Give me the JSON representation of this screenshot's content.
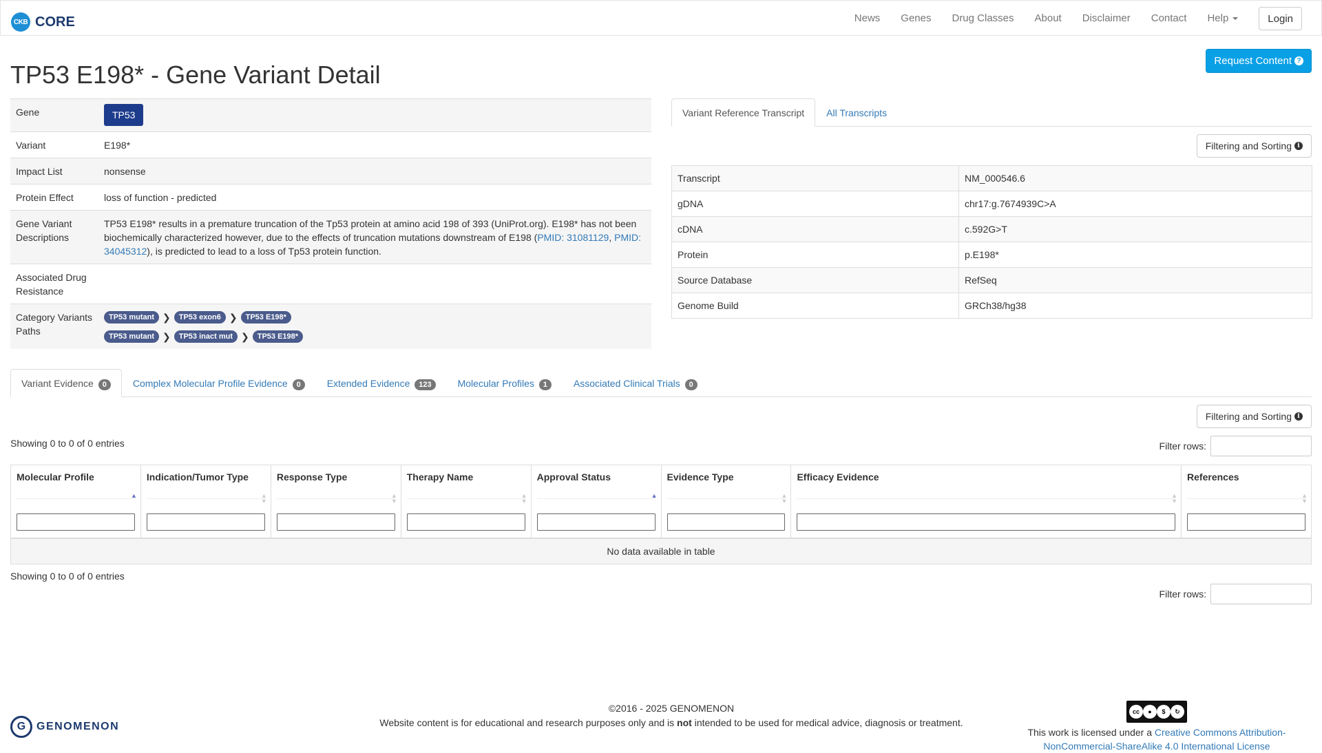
{
  "nav": {
    "brand_logo": "CKB",
    "brand_text": "CORE",
    "links": [
      "News",
      "Genes",
      "Drug Classes",
      "About",
      "Disclaimer",
      "Contact"
    ],
    "help": "Help",
    "login": "Login"
  },
  "page": {
    "title": "TP53 E198* - Gene Variant Detail",
    "request_content": "Request Content"
  },
  "gene_details": {
    "gene_label": "Gene",
    "gene_value": "TP53",
    "variant_label": "Variant",
    "variant_value": "E198*",
    "impact_label": "Impact List",
    "impact_value": "nonsense",
    "protein_effect_label": "Protein Effect",
    "protein_effect_value": "loss of function - predicted",
    "description_label": "Gene Variant Descriptions",
    "description_text_1": "TP53 E198* results in a premature truncation of the Tp53 protein at amino acid 198 of 393 (UniProt.org). E198* has not been biochemically characterized however, due to the effects of truncation mutations downstream of E198 (",
    "description_link_1": "PMID: 31081129",
    "description_sep": ", ",
    "description_link_2": "PMID: 34045312",
    "description_text_2": "), is predicted to lead to a loss of Tp53 protein function.",
    "drug_resistance_label": "Associated Drug Resistance",
    "category_paths_label": "Category Variants Paths",
    "path_1": [
      "TP53 mutant",
      "TP53 exon6",
      "TP53 E198*"
    ],
    "path_2": [
      "TP53 mutant",
      "TP53 inact mut",
      "TP53 E198*"
    ]
  },
  "transcript_tabs": {
    "active": "Variant Reference Transcript",
    "other": "All Transcripts",
    "filter_sort": "Filtering and Sorting"
  },
  "transcript": {
    "rows": [
      {
        "label": "Transcript",
        "value": "NM_000546.6"
      },
      {
        "label": "gDNA",
        "value": "chr17:g.7674939C>A"
      },
      {
        "label": "cDNA",
        "value": "c.592G>T"
      },
      {
        "label": "Protein",
        "value": "p.E198*"
      },
      {
        "label": "Source Database",
        "value": "RefSeq"
      },
      {
        "label": "Genome Build",
        "value": "GRCh38/hg38"
      }
    ]
  },
  "evidence_tabs": [
    {
      "label": "Variant Evidence",
      "count": "0"
    },
    {
      "label": "Complex Molecular Profile Evidence",
      "count": "0"
    },
    {
      "label": "Extended Evidence",
      "count": "123"
    },
    {
      "label": "Molecular Profiles",
      "count": "1"
    },
    {
      "label": "Associated Clinical Trials",
      "count": "0"
    }
  ],
  "evidence": {
    "filter_sort": "Filtering and Sorting",
    "showing_top": "Showing 0 to 0 of 0 entries",
    "showing_bottom": "Showing 0 to 0 of 0 entries",
    "filter_rows_label": "Filter rows:",
    "columns": [
      "Molecular Profile",
      "Indication/Tumor Type",
      "Response Type",
      "Therapy Name",
      "Approval Status",
      "Evidence Type",
      "Efficacy Evidence",
      "References"
    ],
    "empty_message": "No data available in table"
  },
  "footer": {
    "company": "GENOMENON",
    "copyright": "©2016 - 2025 GENOMENON",
    "disclaimer_1": "Website content is for educational and research purposes only and is ",
    "disclaimer_bold": "not",
    "disclaimer_2": " intended to be used for medical advice, diagnosis or treatment.",
    "license_prefix": "This work is licensed under a ",
    "license_link": "Creative Commons Attribution-NonCommercial-ShareAlike 4.0 International License"
  },
  "colors": {
    "primary_button": "#09a0e6",
    "gene_badge": "#1e3c8c",
    "pill": "#4a5b8c",
    "link": "#337ab7"
  }
}
